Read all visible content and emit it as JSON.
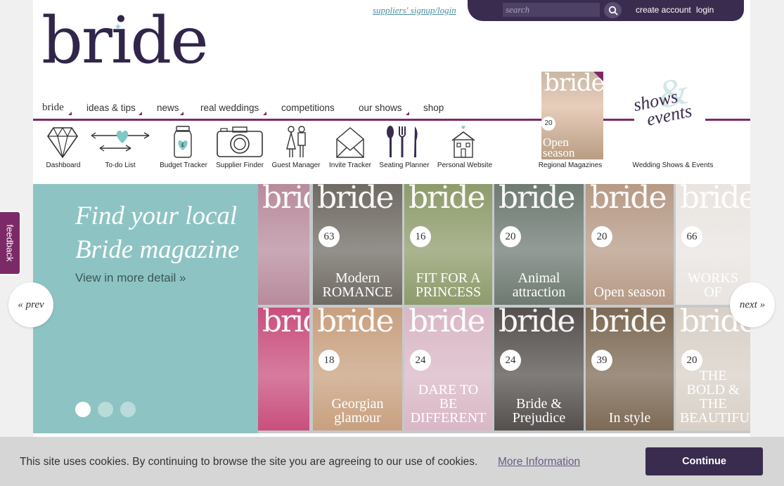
{
  "header": {
    "supplier_link": "suppliers' signup/login",
    "search_placeholder": "search",
    "create_account": "create account",
    "login": "login"
  },
  "logo": {
    "text": "bride"
  },
  "nav": {
    "items": [
      {
        "label": "bride"
      },
      {
        "label": "ideas & tips"
      },
      {
        "label": "news"
      },
      {
        "label": "real weddings"
      },
      {
        "label": "competitions"
      },
      {
        "label": "our shows"
      },
      {
        "label": "shop"
      }
    ]
  },
  "tools": [
    {
      "label": "Dashboard",
      "icon": "diamond-icon"
    },
    {
      "label": "To-do List",
      "icon": "heart-arrow-icon"
    },
    {
      "label": "Budget Tracker",
      "icon": "jar-icon"
    },
    {
      "label": "Supplier Finder",
      "icon": "camera-icon"
    },
    {
      "label": "Guest Manager",
      "icon": "couple-icon"
    },
    {
      "label": "Invite Tracker",
      "icon": "envelope-icon"
    },
    {
      "label": "Seating Planner",
      "icon": "cutlery-icon"
    },
    {
      "label": "Personal Website",
      "icon": "house-icon"
    }
  ],
  "regional": {
    "label": "Regional Magazines",
    "cover_mast": "bride",
    "cover_number": "20",
    "cover_title": "Open season"
  },
  "shows": {
    "label": "Wedding Shows & Events",
    "logo_line1": "shows",
    "logo_line2": "events"
  },
  "hero": {
    "heading": "Find your local Bride magazine",
    "subtext": "View in more detail »",
    "prev": "« prev",
    "next": "next »",
    "slide_count": 3,
    "active_slide": 1,
    "covers": [
      {
        "mast": "bride",
        "badge": "",
        "title": "",
        "color": "#b88b9c"
      },
      {
        "mast": "bride",
        "badge": "63",
        "title": "Modern ROMANCE",
        "color": "#6f6a63"
      },
      {
        "mast": "bride",
        "badge": "16",
        "title": "FIT FOR A PRINCESS",
        "color": "#8e9b6b"
      },
      {
        "mast": "bride",
        "badge": "20",
        "title": "Animal attraction",
        "color": "#6e7a72"
      },
      {
        "mast": "bride",
        "badge": "20",
        "title": "Open season",
        "color": "#b69a86"
      },
      {
        "mast": "bride",
        "badge": "66",
        "title": "WORKS OF",
        "color": "#e9e4e0"
      },
      {
        "mast": "bride",
        "badge": "",
        "title": "",
        "color": "#c94f7c"
      },
      {
        "mast": "bride",
        "badge": "18",
        "title": "Georgian glamour",
        "color": "#c8a07f"
      },
      {
        "mast": "bride",
        "badge": "24",
        "title": "DARE TO BE DIFFERENT",
        "color": "#d9b7c6"
      },
      {
        "mast": "bride",
        "badge": "24",
        "title": "Bride & Prejudice",
        "color": "#55504d"
      },
      {
        "mast": "bride",
        "badge": "39",
        "title": "In style",
        "color": "#7d6a55"
      },
      {
        "mast": "bride",
        "badge": "20",
        "title": "THE BOLD & THE BEAUTIFUL",
        "color": "#d8d0c7"
      }
    ]
  },
  "feedback": "feedback",
  "cookie": {
    "text": "This site uses cookies. By continuing to browse the site you are agreeing to our use of cookies.",
    "more": "More Information",
    "button": "Continue"
  }
}
